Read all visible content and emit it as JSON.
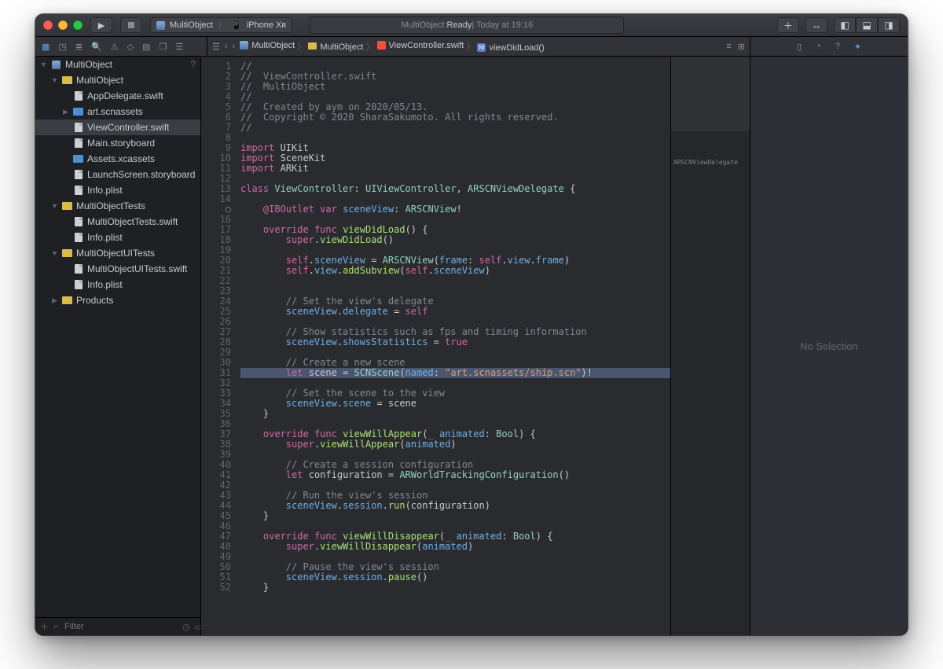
{
  "toolbar": {
    "scheme_target": "MultiObject",
    "scheme_device": "iPhone Xʀ",
    "status_prefix": "MultiObject: ",
    "status_ready": "Ready",
    "status_suffix": " | Today at 19:16"
  },
  "breadcrumb": [
    {
      "icon": "app",
      "label": "MultiObject"
    },
    {
      "icon": "folder",
      "label": "MultiObject"
    },
    {
      "icon": "swift",
      "label": "ViewController.swift"
    },
    {
      "icon": "method",
      "label": "viewDidLoad()"
    }
  ],
  "sidebar": {
    "filter_placeholder": "Filter",
    "tree": [
      {
        "depth": 0,
        "disc": "▼",
        "icon": "app",
        "label": "MultiObject",
        "aux": "?"
      },
      {
        "depth": 1,
        "disc": "▼",
        "icon": "folder-y",
        "label": "MultiObject"
      },
      {
        "depth": 2,
        "disc": "",
        "icon": "file",
        "label": "AppDelegate.swift"
      },
      {
        "depth": 2,
        "disc": "▶",
        "icon": "folder-b",
        "label": "art.scnassets"
      },
      {
        "depth": 2,
        "disc": "",
        "icon": "file",
        "label": "ViewController.swift",
        "selected": true
      },
      {
        "depth": 2,
        "disc": "",
        "icon": "file",
        "label": "Main.storyboard"
      },
      {
        "depth": 2,
        "disc": "",
        "icon": "folder-b",
        "label": "Assets.xcassets"
      },
      {
        "depth": 2,
        "disc": "",
        "icon": "file",
        "label": "LaunchScreen.storyboard"
      },
      {
        "depth": 2,
        "disc": "",
        "icon": "file",
        "label": "Info.plist"
      },
      {
        "depth": 1,
        "disc": "▼",
        "icon": "folder-y",
        "label": "MultiObjectTests"
      },
      {
        "depth": 2,
        "disc": "",
        "icon": "file",
        "label": "MultiObjectTests.swift"
      },
      {
        "depth": 2,
        "disc": "",
        "icon": "file",
        "label": "Info.plist"
      },
      {
        "depth": 1,
        "disc": "▼",
        "icon": "folder-y",
        "label": "MultiObjectUITests"
      },
      {
        "depth": 2,
        "disc": "",
        "icon": "file",
        "label": "MultiObjectUITests.swift"
      },
      {
        "depth": 2,
        "disc": "",
        "icon": "file",
        "label": "Info.plist"
      },
      {
        "depth": 1,
        "disc": "▶",
        "icon": "folder-y",
        "label": "Products"
      }
    ]
  },
  "minimap_label": "ARSCNViewDelegate",
  "inspector_text": "No Selection",
  "code": {
    "highlight_line": 31,
    "circle_line": 15,
    "lines": [
      {
        "n": 1,
        "tokens": [
          [
            "c",
            "//"
          ]
        ]
      },
      {
        "n": 2,
        "tokens": [
          [
            "c",
            "//  ViewController.swift"
          ]
        ]
      },
      {
        "n": 3,
        "tokens": [
          [
            "c",
            "//  MultiObject"
          ]
        ]
      },
      {
        "n": 4,
        "tokens": [
          [
            "c",
            "//"
          ]
        ]
      },
      {
        "n": 5,
        "tokens": [
          [
            "c",
            "//  Created by aym on 2020/05/13."
          ]
        ]
      },
      {
        "n": 6,
        "tokens": [
          [
            "c",
            "//  Copyright © 2020 SharaSakumoto. All rights reserved."
          ]
        ]
      },
      {
        "n": 7,
        "tokens": [
          [
            "c",
            "//"
          ]
        ]
      },
      {
        "n": 8,
        "tokens": []
      },
      {
        "n": 9,
        "tokens": [
          [
            "kw",
            "import"
          ],
          [
            "id",
            " UIKit"
          ]
        ]
      },
      {
        "n": 10,
        "tokens": [
          [
            "kw",
            "import"
          ],
          [
            "id",
            " SceneKit"
          ]
        ]
      },
      {
        "n": 11,
        "tokens": [
          [
            "kw",
            "import"
          ],
          [
            "id",
            " ARKit"
          ]
        ]
      },
      {
        "n": 12,
        "tokens": []
      },
      {
        "n": 13,
        "tokens": [
          [
            "kw",
            "class"
          ],
          [
            "id",
            " "
          ],
          [
            "ty",
            "ViewController"
          ],
          [
            "id",
            ": "
          ],
          [
            "ty",
            "UIViewController"
          ],
          [
            "id",
            ", "
          ],
          [
            "ty",
            "ARSCNViewDelegate"
          ],
          [
            "id",
            " {"
          ]
        ]
      },
      {
        "n": 14,
        "tokens": []
      },
      {
        "n": 15,
        "tokens": [
          [
            "id",
            "    "
          ],
          [
            "kw",
            "@IBOutlet"
          ],
          [
            "id",
            " "
          ],
          [
            "kw",
            "var"
          ],
          [
            "id",
            " "
          ],
          [
            "pr",
            "sceneView"
          ],
          [
            "id",
            ": "
          ],
          [
            "ty",
            "ARSCNView"
          ],
          [
            "id",
            "!"
          ]
        ]
      },
      {
        "n": 16,
        "tokens": []
      },
      {
        "n": 17,
        "tokens": [
          [
            "id",
            "    "
          ],
          [
            "kw",
            "override"
          ],
          [
            "id",
            " "
          ],
          [
            "kw",
            "func"
          ],
          [
            "id",
            " "
          ],
          [
            "fn",
            "viewDidLoad"
          ],
          [
            "id",
            "() {"
          ]
        ]
      },
      {
        "n": 18,
        "tokens": [
          [
            "id",
            "        "
          ],
          [
            "kw",
            "super"
          ],
          [
            "id",
            "."
          ],
          [
            "fn",
            "viewDidLoad"
          ],
          [
            "id",
            "()"
          ]
        ]
      },
      {
        "n": 19,
        "tokens": []
      },
      {
        "n": 20,
        "tokens": [
          [
            "id",
            "        "
          ],
          [
            "kw",
            "self"
          ],
          [
            "id",
            "."
          ],
          [
            "pr",
            "sceneView"
          ],
          [
            "id",
            " = "
          ],
          [
            "ty",
            "ARSCNView"
          ],
          [
            "id",
            "("
          ],
          [
            "pr",
            "frame"
          ],
          [
            "id",
            ": "
          ],
          [
            "kw",
            "self"
          ],
          [
            "id",
            "."
          ],
          [
            "pr",
            "view"
          ],
          [
            "id",
            "."
          ],
          [
            "pr",
            "frame"
          ],
          [
            "id",
            ")"
          ]
        ]
      },
      {
        "n": 21,
        "tokens": [
          [
            "id",
            "        "
          ],
          [
            "kw",
            "self"
          ],
          [
            "id",
            "."
          ],
          [
            "pr",
            "view"
          ],
          [
            "id",
            "."
          ],
          [
            "fn",
            "addSubview"
          ],
          [
            "id",
            "("
          ],
          [
            "kw",
            "self"
          ],
          [
            "id",
            "."
          ],
          [
            "pr",
            "sceneView"
          ],
          [
            "id",
            ")"
          ]
        ]
      },
      {
        "n": 22,
        "tokens": []
      },
      {
        "n": 23,
        "tokens": []
      },
      {
        "n": 24,
        "tokens": [
          [
            "id",
            "        "
          ],
          [
            "c",
            "// Set the view's delegate"
          ]
        ]
      },
      {
        "n": 25,
        "tokens": [
          [
            "id",
            "        "
          ],
          [
            "pr",
            "sceneView"
          ],
          [
            "id",
            "."
          ],
          [
            "pr",
            "delegate"
          ],
          [
            "id",
            " = "
          ],
          [
            "kw",
            "self"
          ]
        ]
      },
      {
        "n": 26,
        "tokens": []
      },
      {
        "n": 27,
        "tokens": [
          [
            "id",
            "        "
          ],
          [
            "c",
            "// Show statistics such as fps and timing information"
          ]
        ]
      },
      {
        "n": 28,
        "tokens": [
          [
            "id",
            "        "
          ],
          [
            "pr",
            "sceneView"
          ],
          [
            "id",
            "."
          ],
          [
            "pr",
            "showsStatistics"
          ],
          [
            "id",
            " = "
          ],
          [
            "kw",
            "true"
          ]
        ]
      },
      {
        "n": 29,
        "tokens": []
      },
      {
        "n": 30,
        "tokens": [
          [
            "id",
            "        "
          ],
          [
            "c",
            "// Create a new scene"
          ]
        ]
      },
      {
        "n": 31,
        "tokens": [
          [
            "id",
            "        "
          ],
          [
            "kw",
            "let"
          ],
          [
            "id",
            " "
          ],
          [
            "id",
            "scene"
          ],
          [
            "id",
            " = "
          ],
          [
            "ty",
            "SCNScene"
          ],
          [
            "id",
            "("
          ],
          [
            "pr",
            "named"
          ],
          [
            "id",
            ": "
          ],
          [
            "st",
            "\"art.scnassets/ship.scn\""
          ],
          [
            "id",
            ")!"
          ]
        ]
      },
      {
        "n": 32,
        "tokens": []
      },
      {
        "n": 33,
        "tokens": [
          [
            "id",
            "        "
          ],
          [
            "c",
            "// Set the scene to the view"
          ]
        ]
      },
      {
        "n": 34,
        "tokens": [
          [
            "id",
            "        "
          ],
          [
            "pr",
            "sceneView"
          ],
          [
            "id",
            "."
          ],
          [
            "pr",
            "scene"
          ],
          [
            "id",
            " = "
          ],
          [
            "id",
            "scene"
          ]
        ]
      },
      {
        "n": 35,
        "tokens": [
          [
            "id",
            "    }"
          ]
        ]
      },
      {
        "n": 36,
        "tokens": []
      },
      {
        "n": 37,
        "tokens": [
          [
            "id",
            "    "
          ],
          [
            "kw",
            "override"
          ],
          [
            "id",
            " "
          ],
          [
            "kw",
            "func"
          ],
          [
            "id",
            " "
          ],
          [
            "fn",
            "viewWillAppear"
          ],
          [
            "id",
            "("
          ],
          [
            "kw",
            "_"
          ],
          [
            "id",
            " "
          ],
          [
            "pr",
            "animated"
          ],
          [
            "id",
            ": "
          ],
          [
            "ty",
            "Bool"
          ],
          [
            "id",
            ") {"
          ]
        ]
      },
      {
        "n": 38,
        "tokens": [
          [
            "id",
            "        "
          ],
          [
            "kw",
            "super"
          ],
          [
            "id",
            "."
          ],
          [
            "fn",
            "viewWillAppear"
          ],
          [
            "id",
            "("
          ],
          [
            "pr",
            "animated"
          ],
          [
            "id",
            ")"
          ]
        ]
      },
      {
        "n": 39,
        "tokens": []
      },
      {
        "n": 40,
        "tokens": [
          [
            "id",
            "        "
          ],
          [
            "c",
            "// Create a session configuration"
          ]
        ]
      },
      {
        "n": 41,
        "tokens": [
          [
            "id",
            "        "
          ],
          [
            "kw",
            "let"
          ],
          [
            "id",
            " "
          ],
          [
            "id",
            "configuration"
          ],
          [
            "id",
            " = "
          ],
          [
            "ty",
            "ARWorldTrackingConfiguration"
          ],
          [
            "id",
            "()"
          ]
        ]
      },
      {
        "n": 42,
        "tokens": []
      },
      {
        "n": 43,
        "tokens": [
          [
            "id",
            "        "
          ],
          [
            "c",
            "// Run the view's session"
          ]
        ]
      },
      {
        "n": 44,
        "tokens": [
          [
            "id",
            "        "
          ],
          [
            "pr",
            "sceneView"
          ],
          [
            "id",
            "."
          ],
          [
            "pr",
            "session"
          ],
          [
            "id",
            "."
          ],
          [
            "fn",
            "run"
          ],
          [
            "id",
            "("
          ],
          [
            "id",
            "configuration"
          ],
          [
            "id",
            ")"
          ]
        ]
      },
      {
        "n": 45,
        "tokens": [
          [
            "id",
            "    }"
          ]
        ]
      },
      {
        "n": 46,
        "tokens": []
      },
      {
        "n": 47,
        "tokens": [
          [
            "id",
            "    "
          ],
          [
            "kw",
            "override"
          ],
          [
            "id",
            " "
          ],
          [
            "kw",
            "func"
          ],
          [
            "id",
            " "
          ],
          [
            "fn",
            "viewWillDisappear"
          ],
          [
            "id",
            "("
          ],
          [
            "kw",
            "_"
          ],
          [
            "id",
            " "
          ],
          [
            "pr",
            "animated"
          ],
          [
            "id",
            ": "
          ],
          [
            "ty",
            "Bool"
          ],
          [
            "id",
            ") {"
          ]
        ]
      },
      {
        "n": 48,
        "tokens": [
          [
            "id",
            "        "
          ],
          [
            "kw",
            "super"
          ],
          [
            "id",
            "."
          ],
          [
            "fn",
            "viewWillDisappear"
          ],
          [
            "id",
            "("
          ],
          [
            "pr",
            "animated"
          ],
          [
            "id",
            ")"
          ]
        ]
      },
      {
        "n": 49,
        "tokens": []
      },
      {
        "n": 50,
        "tokens": [
          [
            "id",
            "        "
          ],
          [
            "c",
            "// Pause the view's session"
          ]
        ]
      },
      {
        "n": 51,
        "tokens": [
          [
            "id",
            "        "
          ],
          [
            "pr",
            "sceneView"
          ],
          [
            "id",
            "."
          ],
          [
            "pr",
            "session"
          ],
          [
            "id",
            "."
          ],
          [
            "fn",
            "pause"
          ],
          [
            "id",
            "()"
          ]
        ]
      },
      {
        "n": 52,
        "tokens": [
          [
            "id",
            "    }"
          ]
        ]
      }
    ]
  }
}
